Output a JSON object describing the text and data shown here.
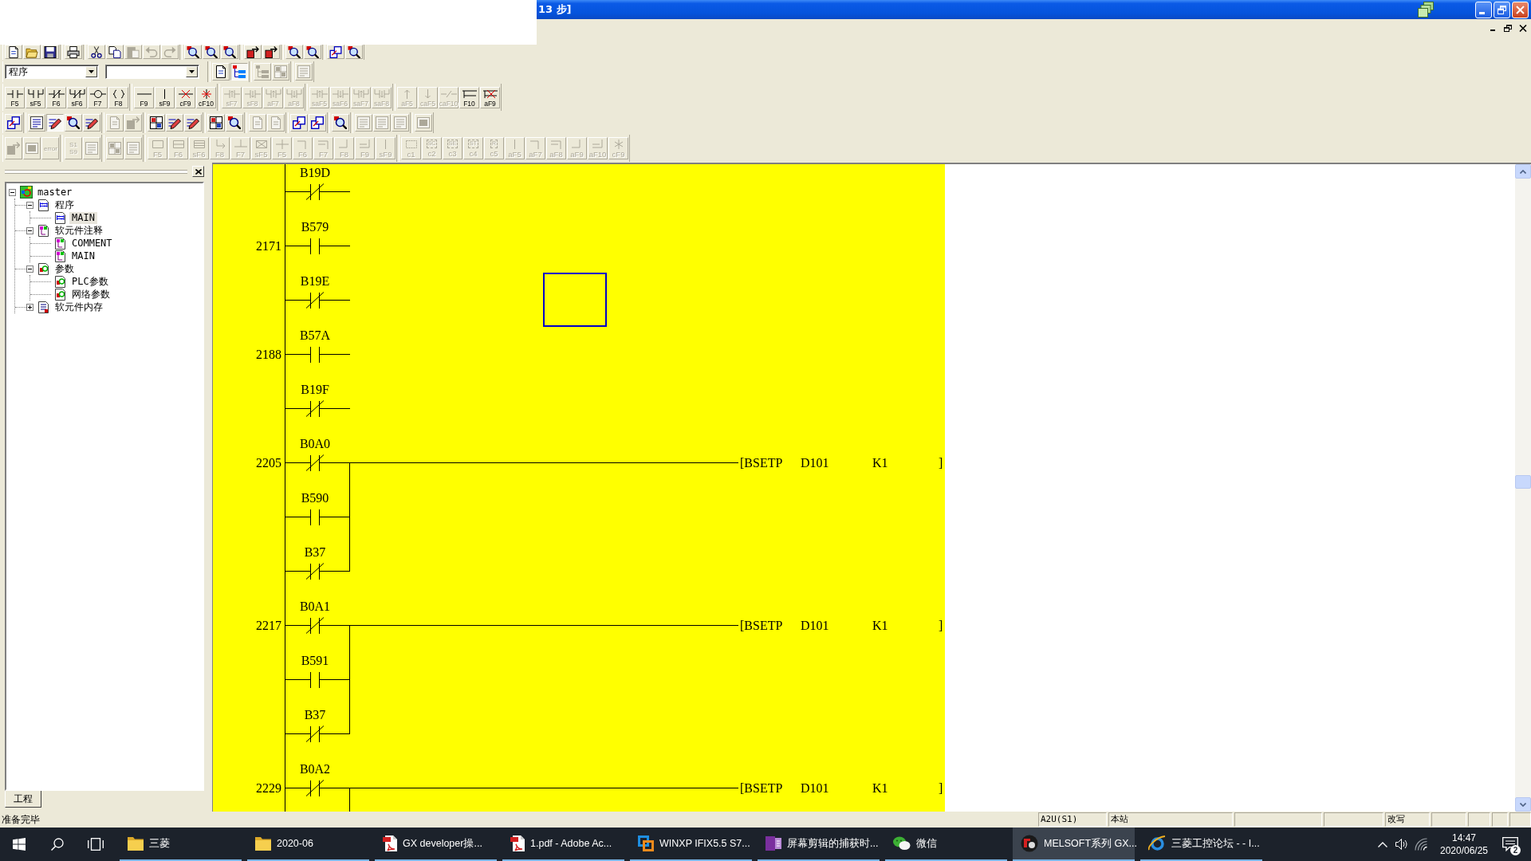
{
  "window": {
    "title": "13 步]"
  },
  "toolbar_rows": [
    {
      "toolbars": [
        {
          "items": [
            {
              "disabled": false
            },
            {
              "disabled": false
            },
            {
              "disabled": false
            }
          ]
        },
        {
          "items": [
            {
              "disabled": false
            }
          ]
        },
        {
          "items": [
            {
              "disabled": false
            },
            {
              "disabled": false
            },
            {
              "disabled": true
            },
            {
              "disabled": true
            },
            {
              "disabled": true
            }
          ]
        },
        {
          "items": [
            {
              "disabled": false
            },
            {
              "disabled": false
            },
            {
              "disabled": false
            }
          ]
        },
        {
          "items": [
            {
              "disabled": false
            },
            {
              "disabled": false
            }
          ]
        },
        {
          "items": [
            {
              "disabled": false
            },
            {
              "disabled": false
            }
          ]
        },
        {
          "items": [
            {
              "disabled": false
            },
            {
              "disabled": false
            }
          ]
        }
      ]
    },
    {
      "toolbars": [
        {
          "items": [
            {
              "kind": "dropdown",
              "value": "程序"
            },
            {
              "kind": "dropdown"
            }
          ]
        },
        {
          "items": [
            {
              "kind": "button",
              "disabled": false,
              "pressed": false
            },
            {
              "kind": "button",
              "disabled": false,
              "pressed": true
            }
          ]
        },
        {
          "items": [
            {
              "kind": "button",
              "disabled": true
            },
            {
              "kind": "button",
              "disabled": true
            }
          ]
        },
        {
          "items": [
            {
              "kind": "button",
              "disabled": true
            }
          ]
        }
      ]
    },
    {
      "toolbars": [
        {
          "items": [
            {
              "label": "F5",
              "disabled": false
            },
            {
              "label": "sF5",
              "disabled": false
            },
            {
              "label": "F6",
              "disabled": false
            },
            {
              "label": "sF6",
              "disabled": false
            },
            {
              "label": "F7",
              "disabled": false
            },
            {
              "label": "F8",
              "disabled": false
            }
          ]
        },
        {
          "items": [
            {
              "label": "F9",
              "disabled": false
            },
            {
              "label": "sF9",
              "disabled": false
            },
            {
              "label": "cF9",
              "disabled": false
            },
            {
              "label": "cF10",
              "disabled": false
            }
          ]
        },
        {
          "items": [
            {
              "label": "sF7",
              "disabled": true
            },
            {
              "label": "sF8",
              "disabled": true
            },
            {
              "label": "aF7",
              "disabled": true
            },
            {
              "label": "aF8",
              "disabled": true
            }
          ]
        },
        {
          "items": [
            {
              "label": "saF5",
              "disabled": true
            },
            {
              "label": "saF6",
              "disabled": true
            },
            {
              "label": "saF7",
              "disabled": true
            },
            {
              "label": "saF8",
              "disabled": true
            }
          ]
        },
        {
          "items": [
            {
              "label": "aF5",
              "disabled": true
            },
            {
              "label": "caF5",
              "disabled": true
            },
            {
              "label": "caF10",
              "disabled": true
            },
            {
              "label": "F10",
              "disabled": false
            },
            {
              "label": "aF9",
              "disabled": false
            }
          ]
        }
      ]
    },
    {
      "toolbars": [
        {
          "items": [
            {
              "disabled": false
            }
          ]
        },
        {
          "items": [
            {
              "disabled": false,
              "pressed": false
            },
            {
              "disabled": false,
              "pressed": true
            },
            {
              "disabled": false,
              "pressed": false
            },
            {
              "disabled": false,
              "pressed": false
            }
          ]
        },
        {
          "items": [
            {
              "disabled": true
            },
            {
              "disabled": true
            }
          ]
        },
        {
          "items": [
            {
              "disabled": false
            },
            {
              "disabled": false
            },
            {
              "disabled": false
            }
          ]
        },
        {
          "items": [
            {
              "disabled": false
            },
            {
              "disabled": false
            }
          ]
        },
        {
          "items": [
            {
              "disabled": true
            },
            {
              "disabled": true
            }
          ]
        },
        {
          "items": [
            {
              "disabled": false
            },
            {
              "disabled": false
            }
          ]
        },
        {
          "items": [
            {
              "disabled": false
            }
          ]
        },
        {
          "items": [
            {
              "disabled": true
            },
            {
              "disabled": true
            },
            {
              "disabled": true
            }
          ]
        },
        {
          "items": [
            {
              "disabled": true
            }
          ]
        }
      ]
    },
    {
      "toolbars": [
        {
          "items": [
            {
              "disabled": true
            },
            {
              "disabled": true
            },
            {
              "glyph_text": "error",
              "disabled": true
            }
          ]
        },
        {
          "items": [
            {
              "glyph_text": "S1 S9",
              "disabled": true
            },
            {
              "disabled": true
            }
          ]
        },
        {
          "items": [
            {
              "disabled": true
            },
            {
              "disabled": true
            }
          ]
        },
        {
          "items": [
            {
              "label": "F5",
              "disabled": true
            },
            {
              "label": "F6",
              "disabled": true
            },
            {
              "label": "sF6",
              "disabled": true
            },
            {
              "label": "F8",
              "disabled": true
            },
            {
              "label": "F7",
              "disabled": true
            },
            {
              "label": "sF5",
              "disabled": true
            },
            {
              "label": "F5",
              "disabled": true
            },
            {
              "label": "F6",
              "disabled": true
            },
            {
              "label": "F7",
              "disabled": true
            },
            {
              "label": "F8",
              "disabled": true
            },
            {
              "label": "F9",
              "disabled": true
            },
            {
              "label": "sF9",
              "disabled": true
            }
          ]
        },
        {
          "items": [
            {
              "label": "c1",
              "disabled": true
            },
            {
              "label": "c2",
              "glyph_text": "SC",
              "disabled": true
            },
            {
              "label": "c3",
              "glyph_text": "SE",
              "disabled": true
            },
            {
              "label": "c4",
              "glyph_text": "ST",
              "disabled": true
            },
            {
              "label": "c5",
              "glyph_text": "R",
              "disabled": true
            },
            {
              "label": "aF5",
              "disabled": true
            },
            {
              "label": "aF7",
              "disabled": true
            },
            {
              "label": "aF8",
              "disabled": true
            },
            {
              "label": "aF9",
              "disabled": true
            },
            {
              "label": "aF10",
              "disabled": true
            },
            {
              "label": "cF9",
              "disabled": true
            }
          ]
        }
      ]
    }
  ],
  "project_tree": {
    "items": [
      {
        "label": "master",
        "expanded": true,
        "selected": false,
        "children": [
          {
            "label": "程序",
            "expanded": true,
            "selected": false,
            "children": [
              {
                "label": "MAIN",
                "selected": true
              }
            ]
          },
          {
            "label": "软元件注释",
            "expanded": true,
            "selected": false,
            "children": [
              {
                "label": "COMMENT",
                "selected": false
              },
              {
                "label": "MAIN",
                "selected": false
              }
            ]
          },
          {
            "label": "参数",
            "expanded": true,
            "selected": false,
            "children": [
              {
                "label": "PLC参数",
                "selected": false
              },
              {
                "label": "网络参数",
                "selected": false
              }
            ]
          },
          {
            "label": "软元件内存",
            "expanded": false,
            "selected": false
          }
        ]
      }
    ]
  },
  "panel_tabs": [
    {
      "label": "工程",
      "selected": true
    }
  ],
  "ladder": {
    "rows": [
      {
        "contact": {
          "label": "B19D",
          "kind": "closed"
        },
        "branch": false,
        "selected": false
      },
      {
        "step": "2171",
        "contact": {
          "label": "B579",
          "kind": "open"
        },
        "branch": false,
        "selected": false
      },
      {
        "contact": {
          "label": "B19E",
          "kind": "closed"
        },
        "branch": false,
        "selected": true
      },
      {
        "step": "2188",
        "contact": {
          "label": "B57A",
          "kind": "open"
        },
        "branch": false,
        "selected": false
      },
      {
        "contact": {
          "label": "B19F",
          "kind": "closed"
        },
        "branch": false,
        "selected": false
      },
      {
        "step": "2205",
        "contact": {
          "label": "B0A0",
          "kind": "closed"
        },
        "branch": false,
        "selected": false,
        "output": {
          "instruction": "[BSETP",
          "operands": [
            "D101",
            "K1"
          ],
          "close": "]"
        }
      },
      {
        "contact": {
          "label": "B590",
          "kind": "open"
        },
        "branch": true,
        "selected": false
      },
      {
        "contact": {
          "label": "B37",
          "kind": "closed"
        },
        "branch": true,
        "selected": false
      },
      {
        "step": "2217",
        "contact": {
          "label": "B0A1",
          "kind": "closed"
        },
        "branch": false,
        "selected": false,
        "output": {
          "instruction": "[BSETP",
          "operands": [
            "D101",
            "K1"
          ],
          "close": "]"
        }
      },
      {
        "contact": {
          "label": "B591",
          "kind": "open"
        },
        "branch": true,
        "selected": false
      },
      {
        "contact": {
          "label": "B37",
          "kind": "closed"
        },
        "branch": true,
        "selected": false
      },
      {
        "step": "2229",
        "contact": {
          "label": "B0A2",
          "kind": "closed"
        },
        "branch": false,
        "selected": false,
        "branch_continues": true,
        "output": {
          "instruction": "[BSETP",
          "operands": [
            "D101",
            "K1"
          ],
          "close": "]"
        }
      }
    ]
  },
  "status_bar": {
    "message": "准备完毕",
    "panes": [
      "A2U(S1)",
      "本站",
      "改写"
    ]
  },
  "taskbar": {
    "apps": [
      {
        "label": "三菱",
        "running": true,
        "active": false
      },
      {
        "label": "2020-06",
        "running": true,
        "active": false
      },
      {
        "label": "GX developer操...",
        "running": true,
        "active": false
      },
      {
        "label": "1.pdf - Adobe Ac...",
        "running": true,
        "active": false
      },
      {
        "label": "WINXP IFIX5.5 S7...",
        "running": true,
        "active": false
      },
      {
        "label": "屏幕剪辑的捕获时...",
        "running": true,
        "active": false
      },
      {
        "label": "微信",
        "running": true,
        "active": false
      },
      {
        "label": "MELSOFT系列 GX...",
        "running": true,
        "active": true
      },
      {
        "label": "三菱工控论坛 - - I...",
        "running": true,
        "active": false
      }
    ],
    "tray": {
      "time": "14:47",
      "date": "2020/06/25",
      "notification_count": "2"
    }
  }
}
